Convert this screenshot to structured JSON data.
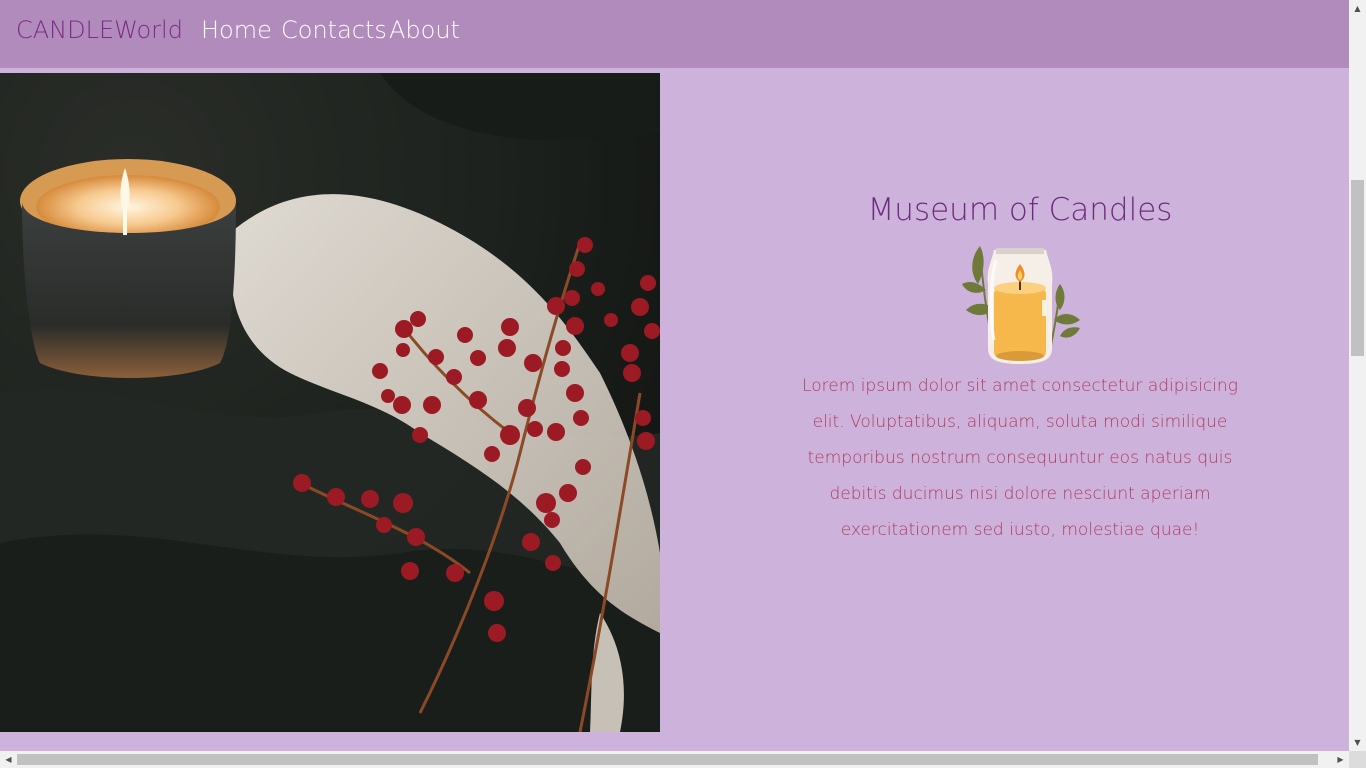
{
  "navbar": {
    "brand": "CANDLEWorld",
    "links": [
      "Home",
      "Contacts",
      "About"
    ]
  },
  "hero": {
    "title": "Museum of Candles",
    "description": "Lorem ipsum dolor sit amet consectetur adipisicing elit. Voluptatibus, aliquam, soluta modi similique temporibus nostrum consequuntur eos natus quis debitis ducimus nisi dolore nesciunt aperiam exercitationem sed iusto, molestiae quae!"
  },
  "images": {
    "photo": "candle-with-berries-photo",
    "icon": "candle-jar-icon"
  },
  "colors": {
    "navbar": "#b18bbc",
    "background": "#cdb3dc",
    "brand": "#7c2b86",
    "title": "#6e2a7d",
    "text": "#b03a5e"
  }
}
